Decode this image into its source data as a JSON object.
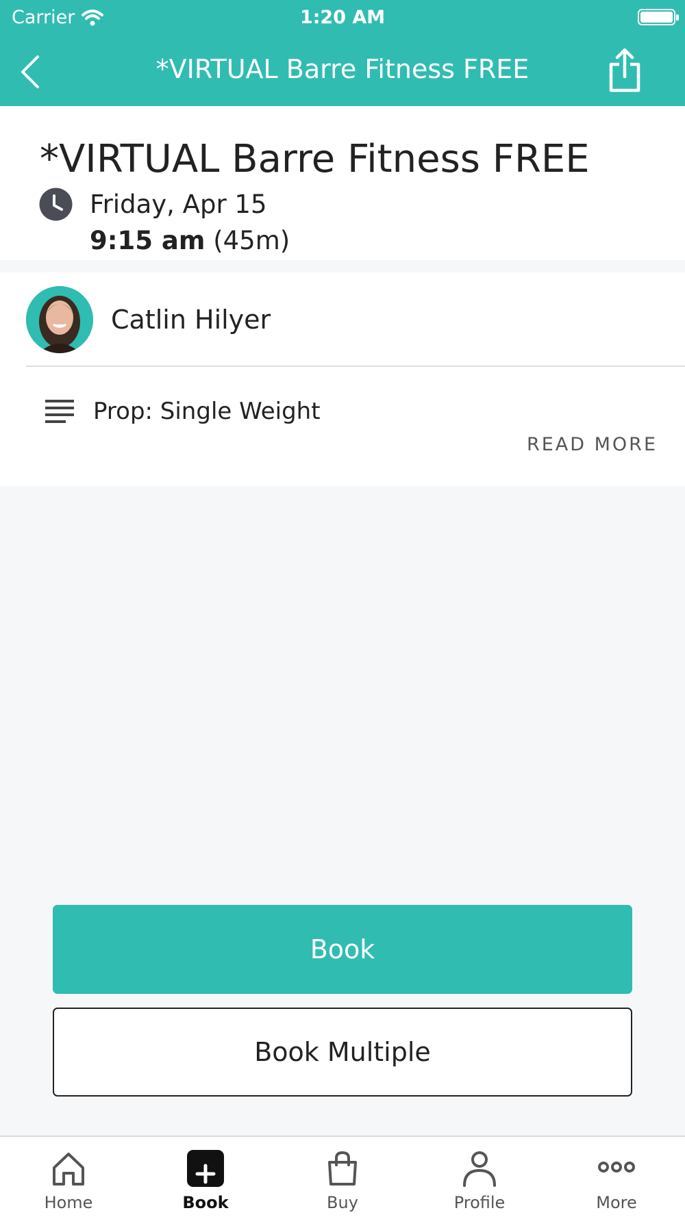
{
  "status_bar": {
    "carrier": "Carrier",
    "time": "1:20 AM"
  },
  "nav": {
    "title": "*VIRTUAL Barre Fitness FREE"
  },
  "class": {
    "title": "*VIRTUAL Barre Fitness FREE",
    "date": "Friday, Apr 15",
    "time": "9:15 am",
    "duration": "(45m)"
  },
  "instructor": {
    "name": "Catlin Hilyer"
  },
  "description": {
    "text": "Prop: Single Weight",
    "read_more": "READ MORE"
  },
  "buttons": {
    "book": "Book",
    "book_multiple": "Book Multiple"
  },
  "tabs": [
    {
      "label": "Home",
      "icon": "home-icon"
    },
    {
      "label": "Book",
      "icon": "plus-square-icon"
    },
    {
      "label": "Buy",
      "icon": "bag-icon"
    },
    {
      "label": "Profile",
      "icon": "user-icon"
    },
    {
      "label": "More",
      "icon": "more-dots-icon"
    }
  ],
  "colors": {
    "accent": "#31bcb2",
    "background": "#f6f7f9",
    "text": "#222222"
  }
}
